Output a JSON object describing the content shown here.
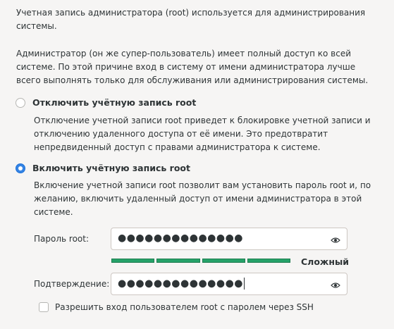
{
  "intro": {
    "text1": "Учетная запись администратора (root) используется для администрирования системы.",
    "text2": "Администратор (он же супер-пользователь) имеет полный доступ ко всей системе. По этой причине вход в систему от имени администратора лучше всего выполнять только для обслуживания или администрирования системы."
  },
  "options": {
    "disable": {
      "label": "Отключить учётную запись root",
      "description": "Отключение учетной записи root приведет к блокировке учетной записи и отключению удаленного доступа от её имени. Это предотвратит непредвиденный доступ с правами администратора к системе.",
      "selected": false
    },
    "enable": {
      "label": "Включить учётную запись root",
      "description": "Включение учетной записи root позволит вам установить пароль root и, по желанию, включить удаленный доступ от имени администратора в этой системе.",
      "selected": true
    }
  },
  "password": {
    "label": "Пароль root:",
    "value_masked": "●●●●●●●●●●●●●●",
    "strength_label": "Сложный",
    "strength_fraction": 1.0,
    "strength_color": "#26a269"
  },
  "confirm": {
    "label": "Подтверждение:",
    "value_masked": "●●●●●●●●●●●●●●"
  },
  "ssh": {
    "label": "Разрешить вход пользователем root с паролем через SSH",
    "checked": false
  },
  "icons": {
    "reveal": "eye-icon"
  }
}
